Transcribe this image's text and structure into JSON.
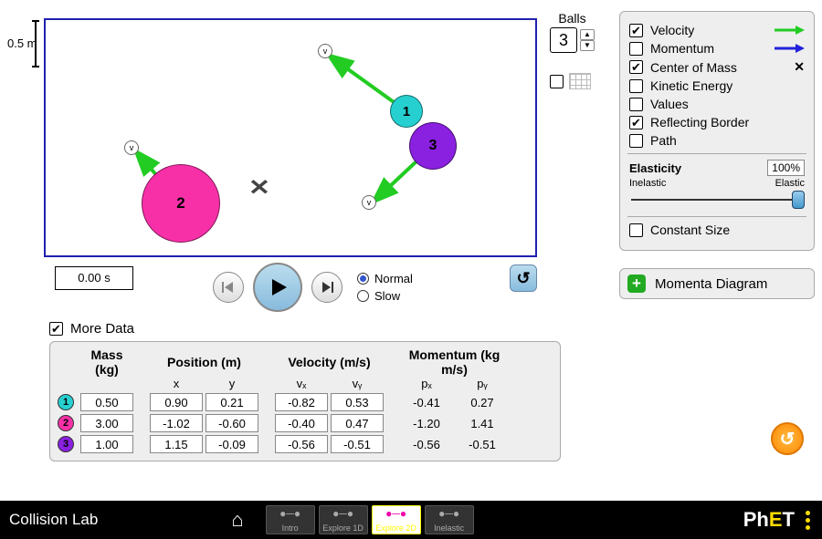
{
  "scale_label": "0.5 m",
  "balls_panel": {
    "label": "Balls",
    "count": "3"
  },
  "grid_on": false,
  "checks": {
    "velocity": {
      "label": "Velocity",
      "on": true
    },
    "momentum": {
      "label": "Momentum",
      "on": false
    },
    "com": {
      "label": "Center of Mass",
      "on": true
    },
    "ke": {
      "label": "Kinetic Energy",
      "on": false
    },
    "values": {
      "label": "Values",
      "on": false
    },
    "reflecting": {
      "label": "Reflecting Border",
      "on": true
    },
    "path": {
      "label": "Path",
      "on": false
    },
    "constant": {
      "label": "Constant Size",
      "on": false
    }
  },
  "elasticity": {
    "label": "Elasticity",
    "value": "100%",
    "lo": "Inelastic",
    "hi": "Elastic"
  },
  "momenta_label": "Momenta Diagram",
  "time": "0.00 s",
  "speed": {
    "normal": "Normal",
    "slow": "Slow",
    "sel": "normal"
  },
  "more_data": {
    "label": "More Data",
    "on": true
  },
  "table": {
    "headers": {
      "mass": "Mass (kg)",
      "position": "Position (m)",
      "velocity": "Velocity (m/s)",
      "momentum": "Momentum (kg m/s)"
    },
    "sub": {
      "x": "x",
      "y": "y",
      "vx": "vₓ",
      "vy": "vᵧ",
      "px": "pₓ",
      "py": "pᵧ"
    },
    "rows": [
      {
        "color": "#26d0d0",
        "mass": "0.50",
        "x": "0.90",
        "y": "0.21",
        "vx": "-0.82",
        "vy": "0.53",
        "px": "-0.41",
        "py": "0.27"
      },
      {
        "color": "#f830a8",
        "mass": "3.00",
        "x": "-1.02",
        "y": "-0.60",
        "vx": "-0.40",
        "vy": "0.47",
        "px": "-1.20",
        "py": "1.41"
      },
      {
        "color": "#8a20e0",
        "mass": "1.00",
        "x": "1.15",
        "y": "-0.09",
        "vx": "-0.56",
        "vy": "-0.51",
        "px": "-0.56",
        "py": "-0.51"
      }
    ]
  },
  "nav": {
    "title": "Collision Lab",
    "screens": [
      "Intro",
      "Explore 1D",
      "Explore 2D",
      "Inelastic"
    ],
    "sel": 2,
    "logo": "PhET"
  }
}
